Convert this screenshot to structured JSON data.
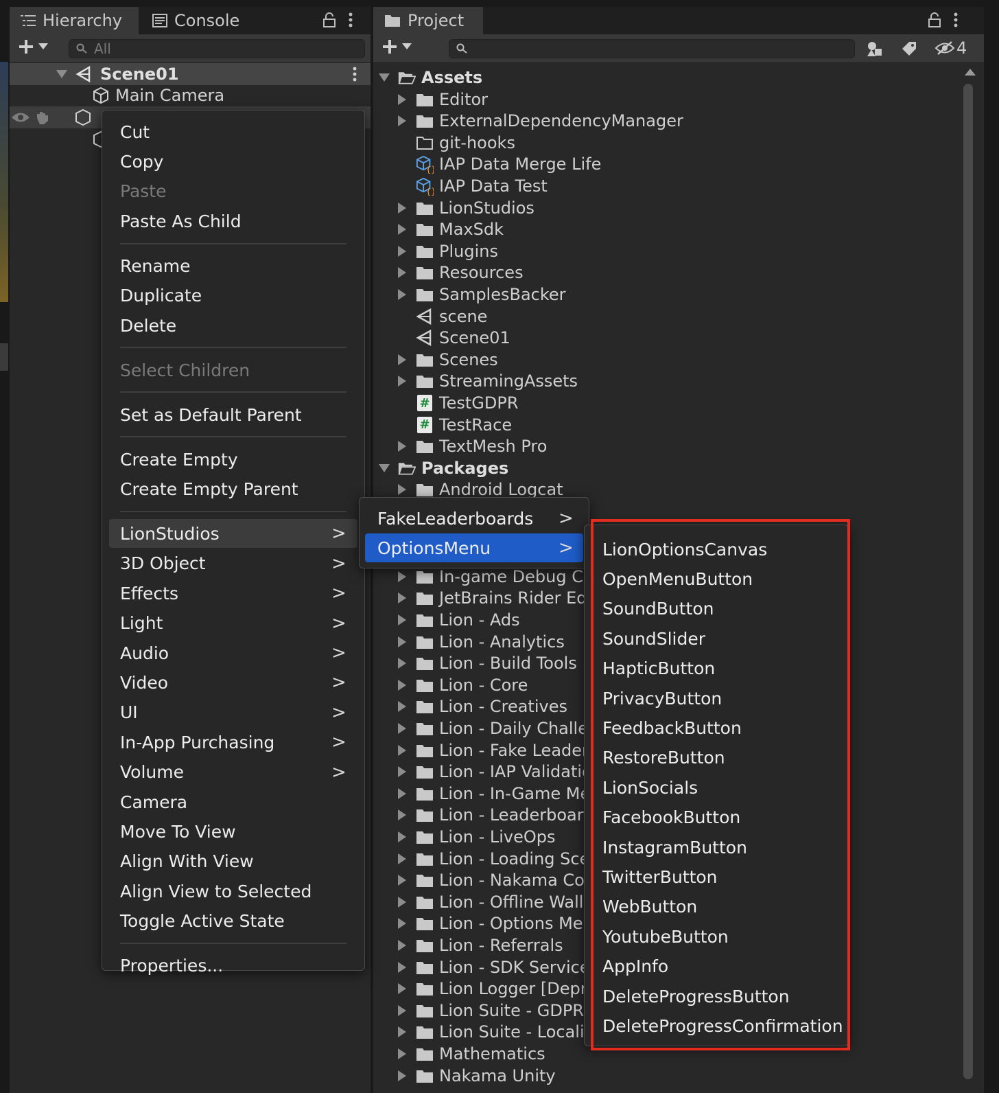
{
  "hierarchy": {
    "tab_hierarchy": "Hierarchy",
    "tab_console": "Console",
    "search_placeholder": "All",
    "scene": "Scene01",
    "items": [
      "Main Camera"
    ]
  },
  "context_menu": {
    "items": [
      {
        "label": "Cut"
      },
      {
        "label": "Copy"
      },
      {
        "label": "Paste"
      },
      {
        "label": "Paste As Child"
      },
      {
        "label": "Rename"
      },
      {
        "label": "Duplicate"
      },
      {
        "label": "Delete"
      },
      {
        "label": "Select Children"
      },
      {
        "label": "Set as Default Parent"
      },
      {
        "label": "Create Empty"
      },
      {
        "label": "Create Empty Parent"
      },
      {
        "label": "LionStudios"
      },
      {
        "label": "3D Object"
      },
      {
        "label": "Effects"
      },
      {
        "label": "Light"
      },
      {
        "label": "Audio"
      },
      {
        "label": "Video"
      },
      {
        "label": "UI"
      },
      {
        "label": "In-App Purchasing"
      },
      {
        "label": "Volume"
      },
      {
        "label": "Camera"
      },
      {
        "label": "Move To View"
      },
      {
        "label": "Align With View"
      },
      {
        "label": "Align View to Selected"
      },
      {
        "label": "Toggle Active State"
      },
      {
        "label": "Properties..."
      }
    ],
    "submenu_arrow": ">"
  },
  "lionstudios_submenu": {
    "items": [
      {
        "label": "FakeLeaderboards"
      },
      {
        "label": "OptionsMenu"
      }
    ]
  },
  "options_submenu": {
    "items": [
      "LionOptionsCanvas",
      "OpenMenuButton",
      "SoundButton",
      "SoundSlider",
      "HapticButton",
      "PrivacyButton",
      "FeedbackButton",
      "RestoreButton",
      "LionSocials",
      "FacebookButton",
      "InstagramButton",
      "TwitterButton",
      "WebButton",
      "YoutubeButton",
      "AppInfo",
      "DeleteProgressButton",
      "DeleteProgressConfirmation"
    ]
  },
  "project": {
    "tab_project": "Project",
    "hidden_count": "4",
    "assets_label": "Assets",
    "assets": [
      "Editor",
      "ExternalDependencyManager",
      "git-hooks",
      "IAP Data Merge Life",
      "IAP Data Test",
      "LionStudios",
      "MaxSdk",
      "Plugins",
      "Resources",
      "SamplesBacker",
      "scene",
      "Scene01",
      "Scenes",
      "StreamingAssets",
      "TestGDPR",
      "TestRace",
      "TextMesh Pro"
    ],
    "packages_label": "Packages",
    "packages": [
      "Android Logcat",
      "In-game Debug Co",
      "JetBrains Rider Edi",
      "Lion - Ads",
      "Lion - Analytics",
      "Lion - Build Tools",
      "Lion - Core",
      "Lion - Creatives",
      "Lion - Daily Challer",
      "Lion - Fake Leader",
      "Lion - IAP Validatio",
      "Lion - In-Game Me",
      "Lion - Leaderboard",
      "Lion - LiveOps",
      "Lion - Loading Sce",
      "Lion - Nakama Cor",
      "Lion - Offline Wall",
      "Lion - Options Men",
      "Lion - Referrals",
      "Lion - SDK Service",
      "Lion Logger [Depre",
      "Lion Suite - GDPR",
      "Lion Suite - Localiz",
      "Mathematics",
      "Nakama Unity"
    ]
  },
  "colors": {
    "highlight_blue": "#1f5cc7",
    "annotation_red": "#e02d1f"
  }
}
